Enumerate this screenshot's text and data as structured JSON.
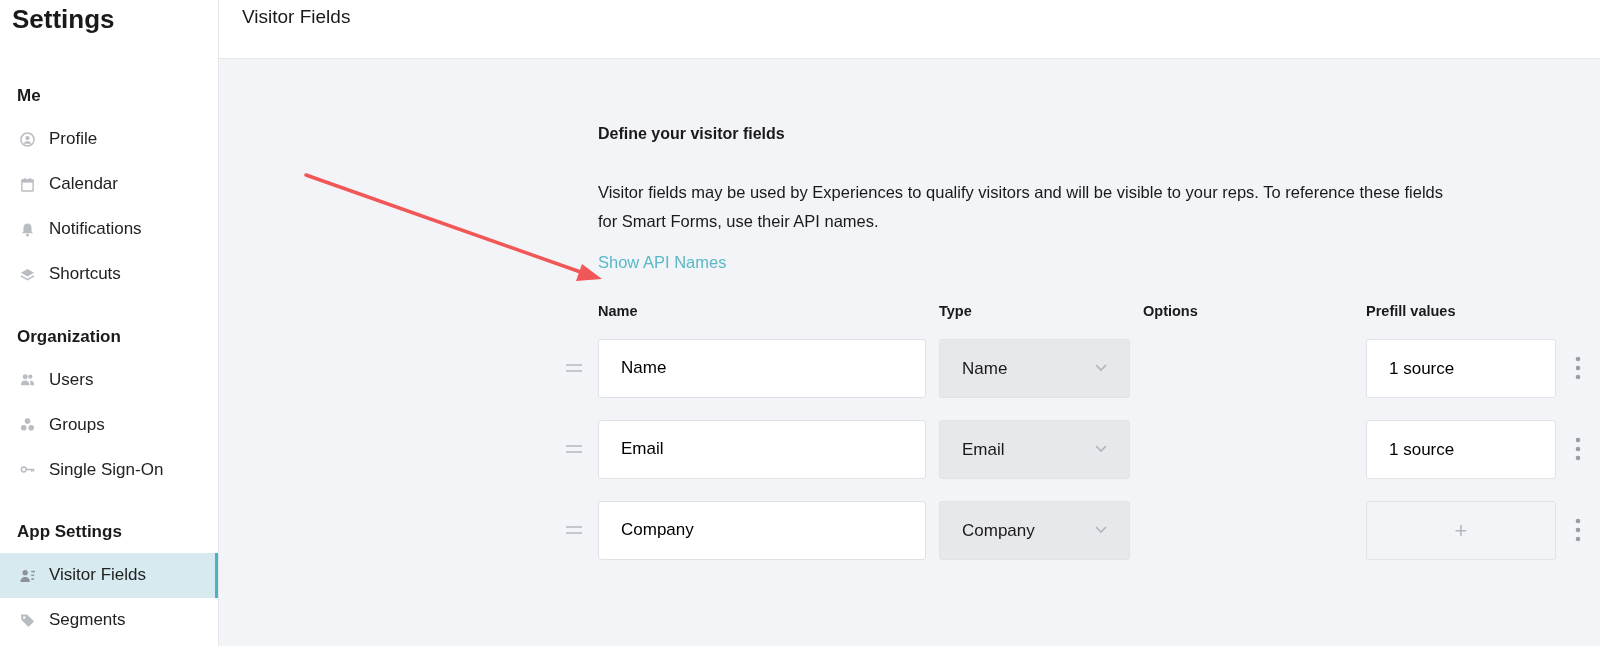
{
  "sidebar": {
    "title": "Settings",
    "sections": [
      {
        "heading": "Me",
        "items": [
          {
            "label": "Profile",
            "selected": false
          },
          {
            "label": "Calendar",
            "selected": false
          },
          {
            "label": "Notifications",
            "selected": false
          },
          {
            "label": "Shortcuts",
            "selected": false
          }
        ]
      },
      {
        "heading": "Organization",
        "items": [
          {
            "label": "Users",
            "selected": false
          },
          {
            "label": "Groups",
            "selected": false
          },
          {
            "label": "Single Sign-On",
            "selected": false
          }
        ]
      },
      {
        "heading": "App Settings",
        "items": [
          {
            "label": "Visitor Fields",
            "selected": true
          },
          {
            "label": "Segments",
            "selected": false
          }
        ]
      }
    ]
  },
  "header": {
    "title": "Visitor Fields"
  },
  "content": {
    "heading": "Define your visitor fields",
    "description": "Visitor fields may be used by Experiences to qualify visitors and will be visible to your reps. To reference these fields for Smart Forms, use their API names.",
    "link": "Show API Names",
    "table": {
      "columns": [
        "Name",
        "Type",
        "Options",
        "Prefill values"
      ],
      "rows": [
        {
          "name": "Name",
          "type": "Name",
          "prefill": {
            "kind": "source",
            "text": "1 source"
          }
        },
        {
          "name": "Email",
          "type": "Email",
          "prefill": {
            "kind": "source",
            "text": "1 source"
          }
        },
        {
          "name": "Company",
          "type": "Company",
          "prefill": {
            "kind": "add",
            "text": "+"
          }
        }
      ]
    }
  }
}
